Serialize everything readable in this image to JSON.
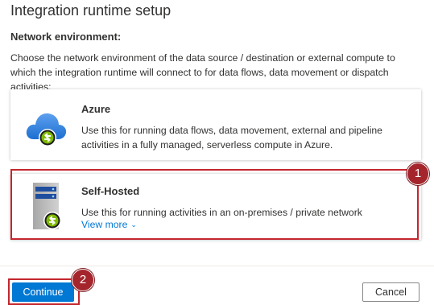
{
  "dialog": {
    "title": "Integration runtime setup",
    "section_label": "Network environment:",
    "description": "Choose the network environment of the data source / destination or external compute to which the integration runtime will connect to for data flows, data movement or dispatch activities:"
  },
  "options": [
    {
      "title": "Azure",
      "description": "Use this for running data flows, data movement, external and pipeline activities in a fully managed, serverless compute in Azure.",
      "icon": "azure-cloud-icon"
    },
    {
      "title": "Self-Hosted",
      "description": "Use this for running activities in an on-premises / private network",
      "link": "View more",
      "icon": "server-icon"
    }
  ],
  "annotations": {
    "step1": "1",
    "step2": "2"
  },
  "footer": {
    "continue_label": "Continue",
    "cancel_label": "Cancel"
  },
  "colors": {
    "accent": "#0078d4",
    "highlight": "#c4262e",
    "badge": "#a4262c"
  }
}
